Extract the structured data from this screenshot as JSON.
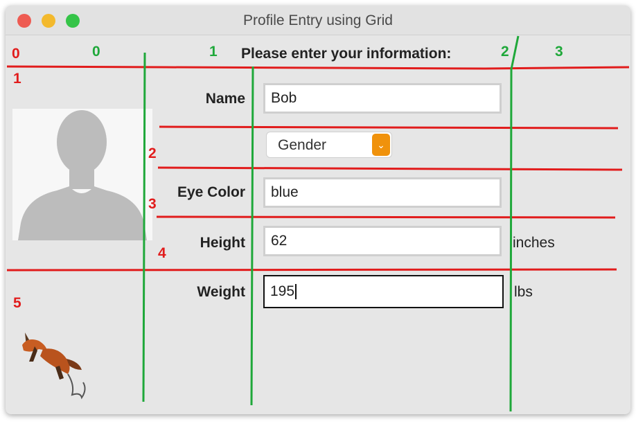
{
  "window": {
    "title": "Profile Entry using Grid"
  },
  "form": {
    "heading": "Please enter your information:",
    "name_label": "Name",
    "name_value": "Bob",
    "gender_value": "Gender",
    "eye_label": "Eye Color",
    "eye_value": "blue",
    "height_label": "Height",
    "height_value": "62",
    "height_unit": "inches",
    "weight_label": "Weight",
    "weight_value": "195",
    "weight_unit": "lbs"
  },
  "annotations": {
    "rows": [
      "0",
      "1",
      "2",
      "3",
      "4",
      "5"
    ],
    "cols": [
      "0",
      "1",
      "2",
      "3"
    ]
  },
  "colors": {
    "row_lines": "#e11c1c",
    "col_lines": "#1fa83a",
    "select_accent": "#f0920c"
  },
  "icons": {
    "photo": "person-silhouette-icon",
    "logo": "fox-logo-icon"
  }
}
